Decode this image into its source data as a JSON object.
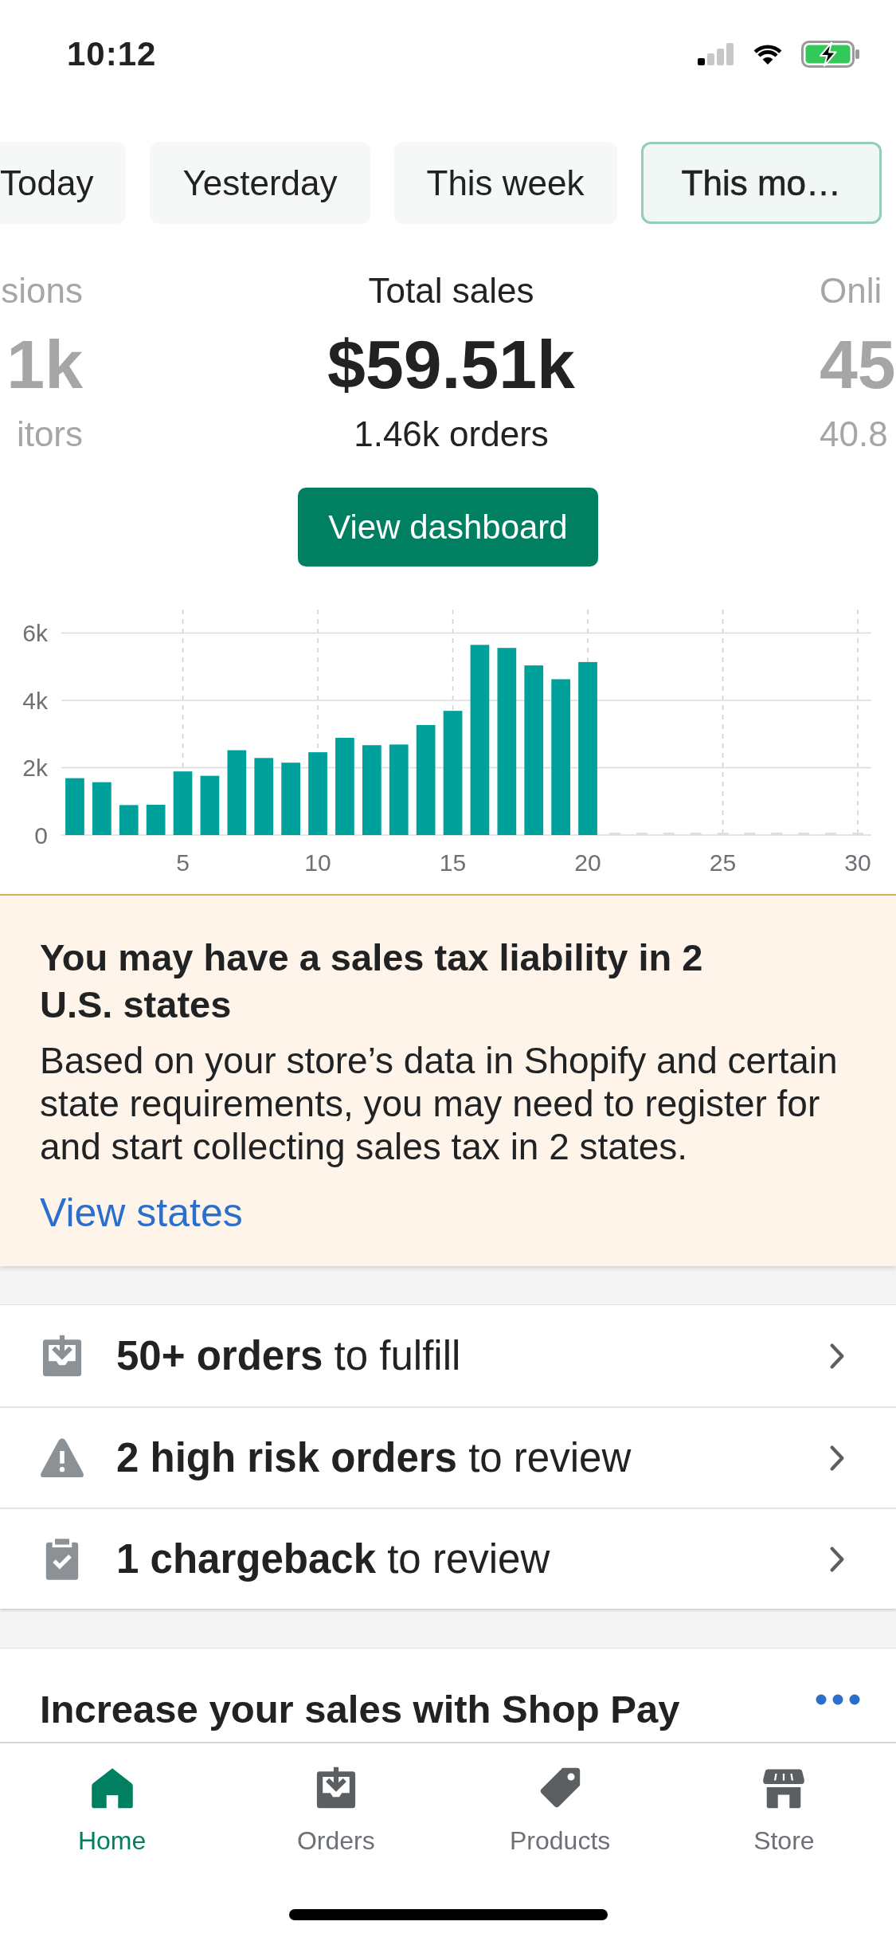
{
  "status_bar": {
    "time": "10:12"
  },
  "date_tabs": [
    {
      "label": "Today",
      "selected": false
    },
    {
      "label": "Yesterday",
      "selected": false
    },
    {
      "label": "This week",
      "selected": false
    },
    {
      "label": "This mo…",
      "selected": true
    }
  ],
  "sales_summary": {
    "metrics": [
      {
        "label": "sions",
        "value": "1k",
        "detail": "itors",
        "selected": false
      },
      {
        "label": "Total sales",
        "value": "$59.51k",
        "detail": "1.46k orders",
        "selected": true
      },
      {
        "label": "Onli",
        "value": "45",
        "detail": "40.8",
        "selected": false
      }
    ],
    "button": "View dashboard"
  },
  "sales_chart": {
    "chart_data": {
      "type": "bar",
      "x": [
        1,
        2,
        3,
        4,
        5,
        6,
        7,
        8,
        9,
        10,
        11,
        12,
        13,
        14,
        15,
        16,
        17,
        18,
        19,
        20,
        21,
        22,
        23,
        24,
        25,
        26,
        27,
        28,
        29,
        30
      ],
      "values": [
        1690,
        1570,
        890,
        900,
        1890,
        1760,
        2520,
        2290,
        2150,
        2460,
        2890,
        2670,
        2690,
        3270,
        3690,
        5650,
        5560,
        5040,
        4630,
        5140,
        0,
        0,
        0,
        0,
        0,
        0,
        0,
        0,
        0,
        0
      ],
      "xlim": [
        0.5,
        30.5
      ],
      "ylim": [
        0,
        6700
      ],
      "xticks": [
        5,
        10,
        15,
        20,
        25,
        30
      ],
      "yticks": [
        {
          "value": 0,
          "label": "0"
        },
        {
          "value": 2000,
          "label": "2k"
        },
        {
          "value": 4000,
          "label": "4k"
        },
        {
          "value": 6000,
          "label": "6k"
        }
      ],
      "grid": true
    }
  },
  "tax_banner": {
    "title": "You may have a sales tax liability in 2 U.S. states",
    "body": "Based on your store’s data in Shopify and certain state requirements, you may need to register for and start collecting sales tax in 2 states.",
    "link": "View states"
  },
  "tasks": [
    {
      "kind": "fulfill",
      "text": "**50+ orders** to fulfill"
    },
    {
      "kind": "risk",
      "text": "**2 high risk orders** to review"
    },
    {
      "kind": "chargeback",
      "text": "**1 chargeback** to review"
    }
  ],
  "promo_card": {
    "title": "Increase your sales with Shop Pay"
  },
  "tab_bar": [
    {
      "kind": "home",
      "label": "Home",
      "selected": true
    },
    {
      "kind": "orders",
      "label": "Orders",
      "selected": false
    },
    {
      "kind": "products",
      "label": "Products",
      "selected": false
    },
    {
      "kind": "store",
      "label": "Store",
      "selected": false
    }
  ]
}
